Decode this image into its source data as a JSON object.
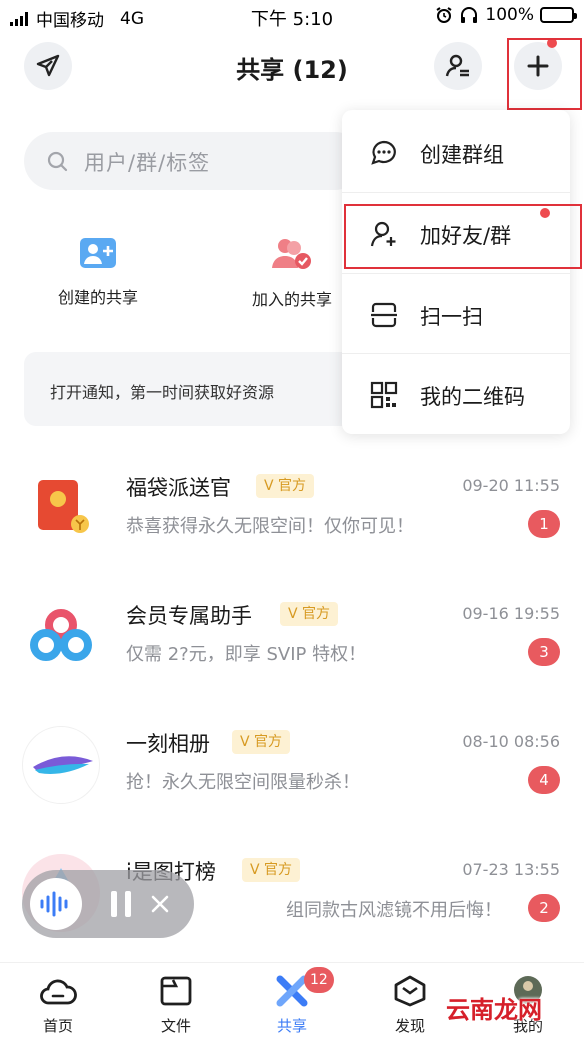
{
  "status_bar": {
    "carrier": "中国移动",
    "network": "4G",
    "time": "下午 5:10",
    "battery": "100%"
  },
  "header": {
    "title": "共享 (12)"
  },
  "search": {
    "placeholder": "用户/群/标签"
  },
  "quick_actions": [
    {
      "label": "创建的共享",
      "icon": "create-share-icon"
    },
    {
      "label": "加入的共享",
      "icon": "joined-share-icon"
    }
  ],
  "notice": {
    "text": "打开通知，第一时间获取好资源"
  },
  "chats": [
    {
      "name": "福袋派送官",
      "badge": "V 官方",
      "time": "09-20 11:55",
      "message": "恭喜获得永久无限空间！仅你可见！",
      "unread": "1"
    },
    {
      "name": "会员专属助手",
      "badge": "V 官方",
      "time": "09-16 19:55",
      "message": "仅需 2?元，即享 SVIP 特权！",
      "unread": "3"
    },
    {
      "name": "一刻相册",
      "badge": "V 官方",
      "time": "08-10 08:56",
      "message": "抢！永久无限空间限量秒杀！",
      "unread": "4"
    },
    {
      "name": "i是图打榜",
      "badge": "V 官方",
      "time": "07-23 13:55",
      "message": "组同款古风滤镜不用后悔！",
      "unread": "2"
    }
  ],
  "menu": {
    "items": [
      {
        "label": "创建群组",
        "icon": "chat-bubble-icon"
      },
      {
        "label": "加好友/群",
        "icon": "add-friend-icon"
      },
      {
        "label": "扫一扫",
        "icon": "scan-icon"
      },
      {
        "label": "我的二维码",
        "icon": "qr-code-icon"
      }
    ]
  },
  "tabbar": {
    "tabs": [
      {
        "label": "首页",
        "icon": "home-cloud-icon"
      },
      {
        "label": "文件",
        "icon": "folder-icon"
      },
      {
        "label": "共享",
        "icon": "share-icon"
      },
      {
        "label": "发现",
        "icon": "discover-icon"
      },
      {
        "label": "我的",
        "icon": "profile-icon"
      }
    ],
    "share_badge": "12"
  },
  "watermark": "云南龙网",
  "colors": {
    "accent_blue": "#3c7cf6",
    "badge_red": "#e85a5f",
    "official_bg": "#fdf1d3",
    "official_text": "#d79a22",
    "highlight_red": "#e0313a"
  }
}
